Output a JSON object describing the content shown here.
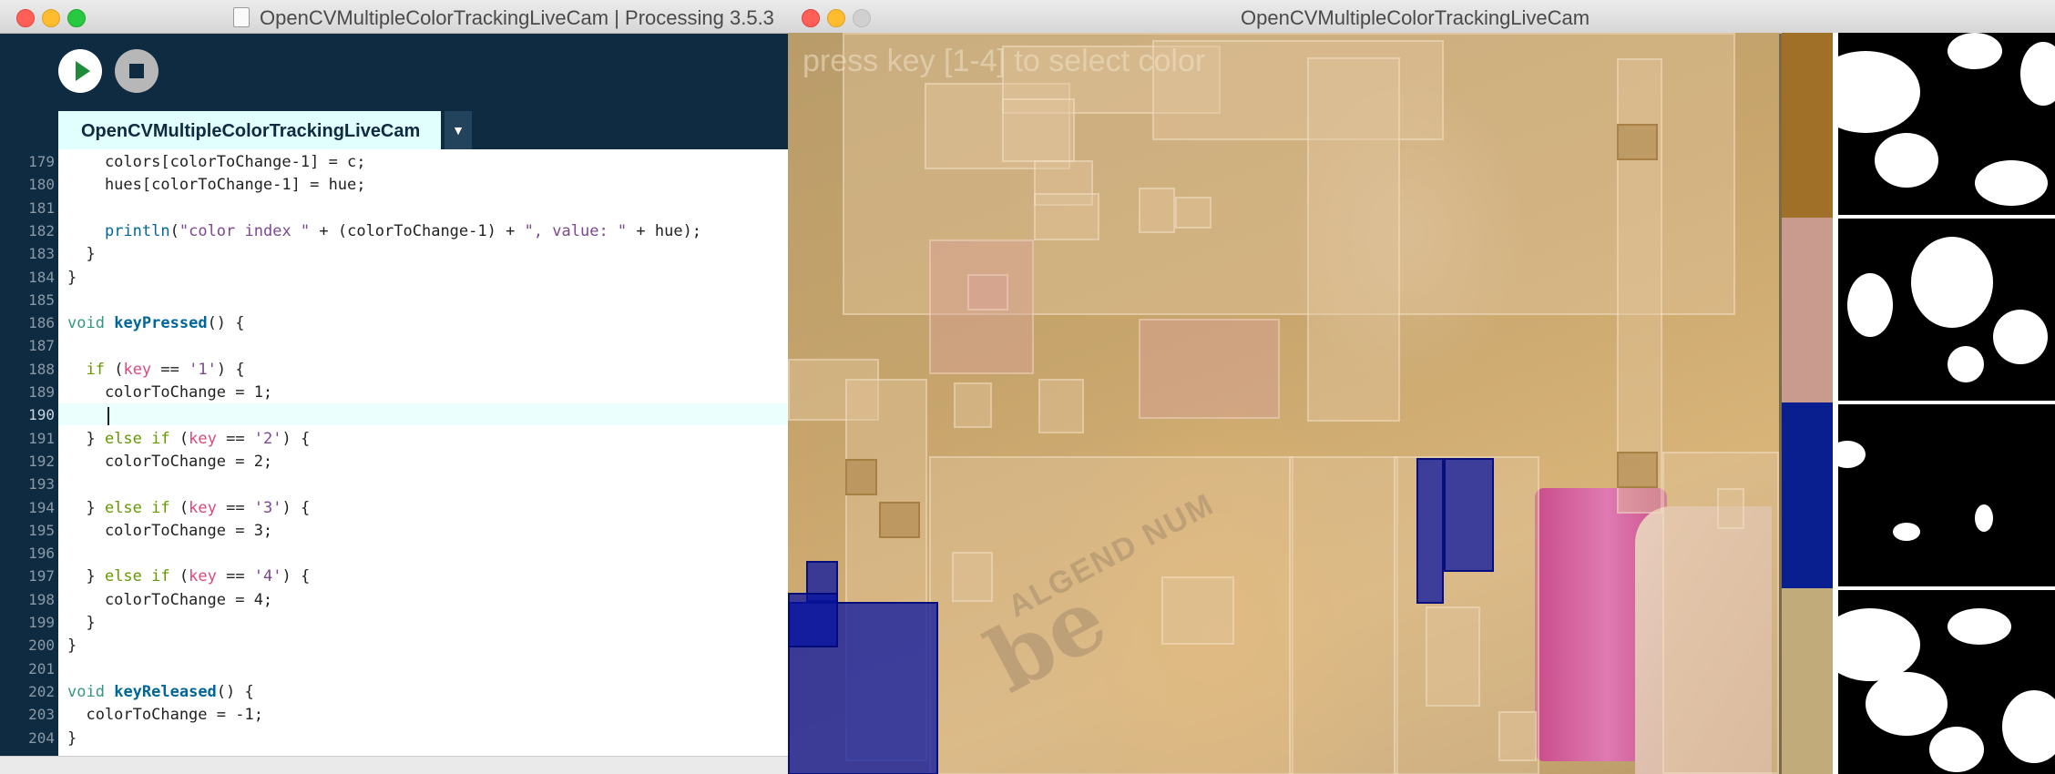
{
  "ide": {
    "window_title": "OpenCVMultipleColorTrackingLiveCam | Processing 3.5.3",
    "tab_label": "OpenCVMultipleColorTrackingLiveCam",
    "tab_menu_icon": "triangle-down-icon",
    "run_icon": "play-icon",
    "stop_icon": "stop-icon",
    "current_line": 190,
    "code": [
      {
        "n": "179",
        "text": "    colors[colorToChange-1] = c;"
      },
      {
        "n": "180",
        "text": "    hues[colorToChange-1] = hue;"
      },
      {
        "n": "181",
        "text": ""
      },
      {
        "n": "182",
        "text": "    println(\"color index \" + (colorToChange-1) + \", value: \" + hue);"
      },
      {
        "n": "183",
        "text": "  }"
      },
      {
        "n": "184",
        "text": "}"
      },
      {
        "n": "185",
        "text": ""
      },
      {
        "n": "186",
        "text": "void keyPressed() {"
      },
      {
        "n": "187",
        "text": ""
      },
      {
        "n": "188",
        "text": "  if (key == '1') {"
      },
      {
        "n": "189",
        "text": "    colorToChange = 1;"
      },
      {
        "n": "190",
        "text": "    "
      },
      {
        "n": "191",
        "text": "  } else if (key == '2') {"
      },
      {
        "n": "192",
        "text": "    colorToChange = 2;"
      },
      {
        "n": "193",
        "text": ""
      },
      {
        "n": "194",
        "text": "  } else if (key == '3') {"
      },
      {
        "n": "195",
        "text": "    colorToChange = 3;"
      },
      {
        "n": "196",
        "text": ""
      },
      {
        "n": "197",
        "text": "  } else if (key == '4') {"
      },
      {
        "n": "198",
        "text": "    colorToChange = 4;"
      },
      {
        "n": "199",
        "text": "  }"
      },
      {
        "n": "200",
        "text": "}"
      },
      {
        "n": "201",
        "text": ""
      },
      {
        "n": "202",
        "text": "void keyReleased() {"
      },
      {
        "n": "203",
        "text": "  colorToChange = -1;"
      },
      {
        "n": "204",
        "text": "}"
      }
    ]
  },
  "sketch": {
    "window_title": "OpenCVMultipleColorTrackingLiveCam",
    "hint_text": "press key [1-4] to select color",
    "book_text": "be",
    "book_brand": "ALGEND NUM",
    "swatch_colors": [
      "#a06f28",
      "#c99a8e",
      "#0a1f8f",
      "#c2ab7a"
    ]
  },
  "colors": {
    "ide_dark": "#0f2b42",
    "tab_bg": "#e0fffd",
    "line_highlight": "#ebfffd",
    "tracking_blue": "#0a1f8f"
  }
}
